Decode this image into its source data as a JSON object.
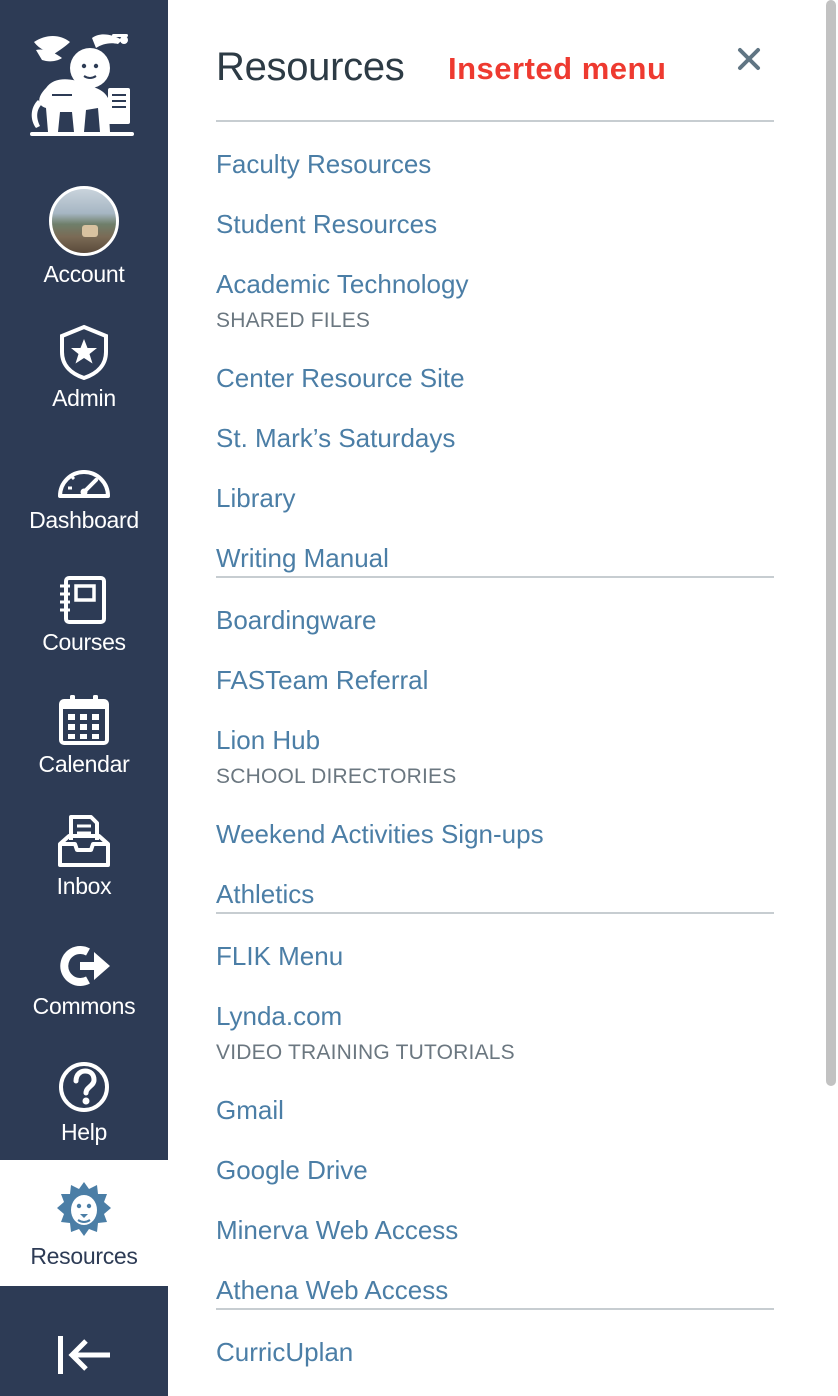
{
  "nav": {
    "items": [
      {
        "label": "Account",
        "icon": "avatar-image"
      },
      {
        "label": "Admin",
        "icon": "shield-star-icon"
      },
      {
        "label": "Dashboard",
        "icon": "speedometer-icon"
      },
      {
        "label": "Courses",
        "icon": "notebook-icon"
      },
      {
        "label": "Calendar",
        "icon": "calendar-icon"
      },
      {
        "label": "Inbox",
        "icon": "inbox-tray-icon"
      },
      {
        "label": "Commons",
        "icon": "commons-arrow-icon"
      },
      {
        "label": "Help",
        "icon": "question-circle-icon"
      },
      {
        "label": "Resources",
        "icon": "lion-head-icon"
      }
    ],
    "active": "Resources",
    "collapse_icon": "collapse-left-arrow-icon"
  },
  "tray": {
    "title": "Resources",
    "annotation": "Inserted menu",
    "close_icon": "close-x-icon",
    "links": [
      {
        "label": "Faculty Resources"
      },
      {
        "label": "Student Resources"
      },
      {
        "label": "Academic Technology"
      },
      {
        "label": "Center Resource Site"
      },
      {
        "label": "St. Mark’s Saturdays"
      },
      {
        "label": "Library"
      },
      {
        "label": "Writing Manual"
      },
      {
        "label": "Boardingware"
      },
      {
        "label": "FASTeam Referral"
      },
      {
        "label": "Lion Hub"
      },
      {
        "label": "Weekend Activities Sign-ups"
      },
      {
        "label": "Athletics"
      },
      {
        "label": "FLIK Menu"
      },
      {
        "label": "Lynda.com"
      },
      {
        "label": "Gmail"
      },
      {
        "label": "Google Drive"
      },
      {
        "label": "Minerva Web Access"
      },
      {
        "label": "Athena Web Access"
      },
      {
        "label": "CurricUplan"
      }
    ],
    "subtitles": {
      "shared_files": "SHARED FILES",
      "school_directories": "SCHOOL DIRECTORIES",
      "video_training": "VIDEO TRAINING TUTORIALS"
    }
  },
  "colors": {
    "nav_bg": "#2d3b55",
    "link": "#4b7ea6",
    "annotation": "#ee3a30",
    "subtitle": "#6b7780",
    "rule": "#c7cdd1"
  }
}
